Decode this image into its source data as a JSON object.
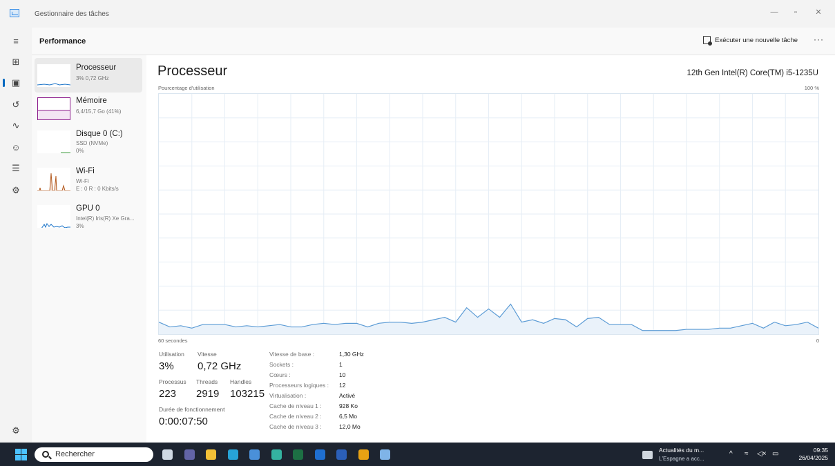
{
  "window": {
    "title": "Gestionnaire des tâches"
  },
  "header": {
    "title": "Performance",
    "run_task_label": "Exécuter une nouvelle tâche",
    "more_label": "···"
  },
  "side_items": [
    {
      "name": "Processeur",
      "sub1": "3% 0,72 GHz",
      "sub2": "",
      "color": "#1a73c8"
    },
    {
      "name": "Mémoire",
      "sub1": "6,4/15,7 Go (41%)",
      "sub2": "",
      "color": "#8b1a8b"
    },
    {
      "name": "Disque 0 (C:)",
      "sub1": "SSD (NVMe)",
      "sub2": "0%",
      "color": "#3b9b3b"
    },
    {
      "name": "Wi-Fi",
      "sub1": "Wi-Fi",
      "sub2": "E : 0 R : 0 Kbits/s",
      "color": "#b35a1f"
    },
    {
      "name": "GPU 0",
      "sub1": "Intel(R) Iris(R) Xe Gra...",
      "sub2": "3%",
      "color": "#1a73c8"
    }
  ],
  "panel": {
    "title": "Processeur",
    "cpu_model": "12th Gen Intel(R) Core(TM) i5-1235U",
    "y_label": "Pourcentage d'utilisation",
    "y_max_label": "100 %",
    "x_left_label": "60 secondes",
    "x_right_label": "0"
  },
  "chart_data": {
    "type": "area",
    "title": "",
    "ylabel": "Pourcentage d'utilisation",
    "ylim": [
      0,
      100
    ],
    "xlim": [
      60,
      0
    ],
    "grid": true,
    "series": [
      {
        "color": "#5b9bd5",
        "values": [
          5,
          3,
          3.5,
          2.5,
          4,
          4,
          4,
          3,
          3.5,
          3,
          3.5,
          4,
          3,
          3,
          4,
          4.5,
          4,
          4.5,
          4.5,
          3,
          4.5,
          5,
          5,
          4.5,
          5,
          6,
          7,
          5,
          11,
          7,
          10.5,
          7,
          12.5,
          5,
          6,
          4.5,
          6.5,
          6,
          3,
          6.5,
          7,
          4,
          4,
          4,
          1.5,
          1.5,
          1.5,
          1.5,
          2,
          2,
          2,
          2.5,
          2.5,
          3.5,
          4.5,
          2.5,
          5,
          3.5,
          4,
          5,
          2.5
        ]
      }
    ]
  },
  "stats": {
    "utilisation_label": "Utilisation",
    "utilisation_value": "3%",
    "vitesse_label": "Vitesse",
    "vitesse_value": "0,72 GHz",
    "processus_label": "Processus",
    "processus_value": "223",
    "threads_label": "Threads",
    "threads_value": "2919",
    "handles_label": "Handles",
    "handles_value": "103215",
    "uptime_label": "Durée de fonctionnement",
    "uptime_value": "0:00:07:50"
  },
  "info": [
    {
      "label": "Vitesse de base :",
      "value": "1,30 GHz"
    },
    {
      "label": "Sockets :",
      "value": "1"
    },
    {
      "label": "Cœurs :",
      "value": "10"
    },
    {
      "label": "Processeurs logiques :",
      "value": "12"
    },
    {
      "label": "Virtualisation :",
      "value": "Activé"
    },
    {
      "label": "Cache de niveau 1 :",
      "value": "928 Ko"
    },
    {
      "label": "Cache de niveau 2 :",
      "value": "6,5 Mo"
    },
    {
      "label": "Cache de niveau 3 :",
      "value": "12,0 Mo"
    }
  ],
  "taskbar": {
    "search_placeholder": "Rechercher",
    "news_title": "Actualités du m...",
    "news_sub": "L'Espagne a acc...",
    "time": "09:35",
    "date": "26/04/2025",
    "apps": [
      {
        "icon": "task-view-icon",
        "color": "#cfd8e3"
      },
      {
        "icon": "teams-icon",
        "color": "#6264a7"
      },
      {
        "icon": "file-explorer-icon",
        "color": "#f2c037"
      },
      {
        "icon": "edge-icon",
        "color": "#27a3d6"
      },
      {
        "icon": "store-icon",
        "color": "#4a90d9"
      },
      {
        "icon": "edge-dev-icon",
        "color": "#34b3a0"
      },
      {
        "icon": "excel-icon",
        "color": "#1d7044"
      },
      {
        "icon": "outlook-icon",
        "color": "#1f6fd1"
      },
      {
        "icon": "word-icon",
        "color": "#2b5fb8"
      },
      {
        "icon": "chrome-icon",
        "color": "#e8a213"
      },
      {
        "icon": "task-manager-icon",
        "color": "#7fb4e8"
      }
    ]
  }
}
